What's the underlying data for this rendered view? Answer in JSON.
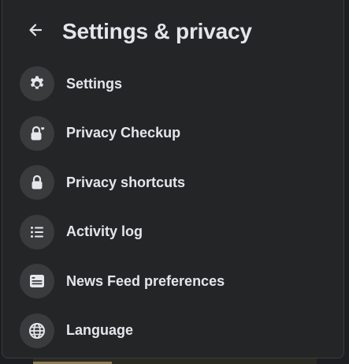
{
  "header": {
    "title": "Settings & privacy",
    "back_icon": "arrow-left-icon"
  },
  "menu": {
    "items": [
      {
        "label": "Settings",
        "icon": "gear-icon"
      },
      {
        "label": "Privacy Checkup",
        "icon": "lock-heart-icon"
      },
      {
        "label": "Privacy shortcuts",
        "icon": "lock-icon"
      },
      {
        "label": "Activity log",
        "icon": "list-icon"
      },
      {
        "label": "News Feed preferences",
        "icon": "feed-icon"
      },
      {
        "label": "Language",
        "icon": "globe-icon"
      }
    ]
  },
  "colors": {
    "panel_background": "#242526",
    "icon_circle": "#3a3b3c",
    "text": "#e4e6eb"
  }
}
